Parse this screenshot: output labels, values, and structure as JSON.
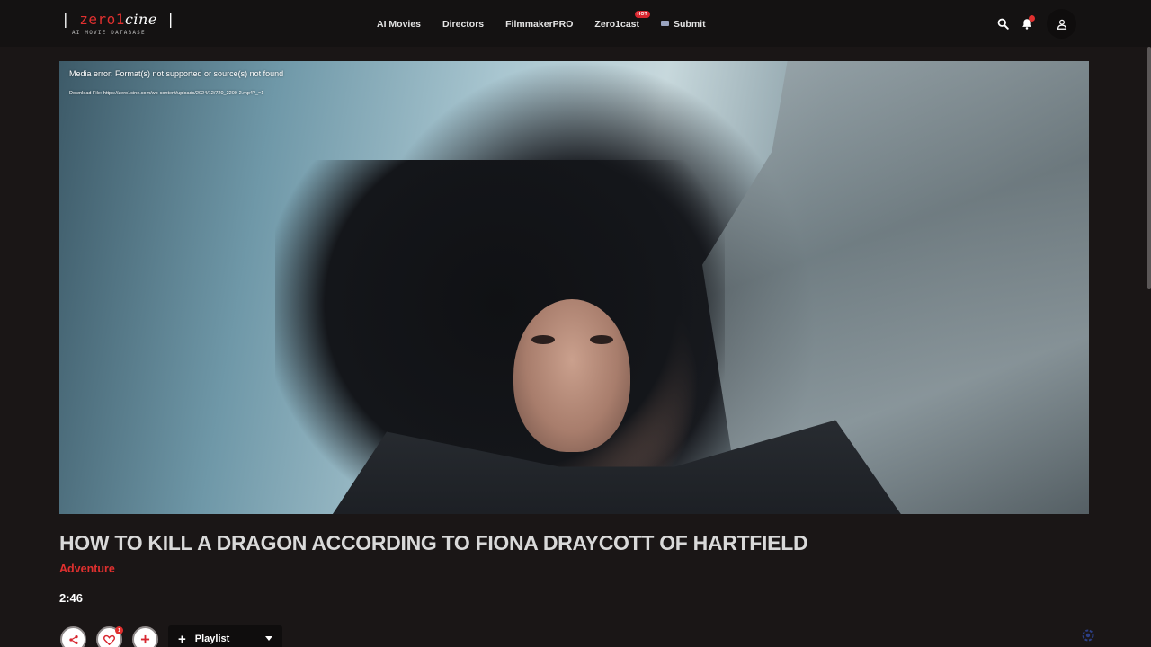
{
  "header": {
    "logo": {
      "part1": "zero",
      "part2": "1",
      "part3": "cine",
      "subtitle": "AI MOVIE DATABASE"
    },
    "nav": [
      {
        "label": "AI Movies"
      },
      {
        "label": "Directors"
      },
      {
        "label": "FilmmakerPRO"
      },
      {
        "label": "Zero1cast",
        "badge": "HOT"
      },
      {
        "label": "Submit"
      }
    ],
    "icons": {
      "search": "search-icon",
      "notifications": "bell-icon",
      "account": "user-icon"
    }
  },
  "player": {
    "error_message": "Media error: Format(s) not supported or source(s) not found",
    "download_text": "Download File: https://zero1cine.com/wp-content/uploads/2024/12/720_2200-2.mp4?_=1"
  },
  "movie": {
    "title": "HOW TO KILL A DRAGON ACCORDING TO FIONA DRAYCOTT OF HARTFIELD",
    "genre": "Adventure",
    "duration": "2:46"
  },
  "actions": {
    "like_count": "1",
    "playlist_label": "Playlist"
  },
  "colors": {
    "accent": "#e0302f",
    "background": "#1a1616",
    "header": "#141212"
  }
}
